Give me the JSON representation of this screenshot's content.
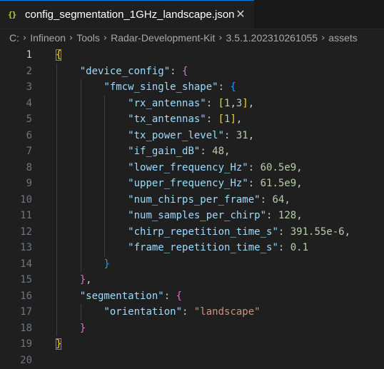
{
  "tab": {
    "icon": "{}",
    "title": "config_segmentation_1GHz_landscape.json",
    "close": "✕"
  },
  "breadcrumb": [
    "C:",
    "Infineon",
    "Tools",
    "Radar-Development-Kit",
    "3.5.1.202310261055",
    "assets"
  ],
  "lines": [
    {
      "num": "1",
      "indent": 0,
      "tokens": [
        {
          "t": "{",
          "c": "b1 bm"
        }
      ]
    },
    {
      "num": "2",
      "indent": 1,
      "tokens": [
        {
          "t": "\"device_config\"",
          "c": "tk-key"
        },
        {
          "t": ": ",
          "c": "tk-p"
        },
        {
          "t": "{",
          "c": "b2"
        }
      ]
    },
    {
      "num": "3",
      "indent": 2,
      "tokens": [
        {
          "t": "\"fmcw_single_shape\"",
          "c": "tk-key"
        },
        {
          "t": ": ",
          "c": "tk-p"
        },
        {
          "t": "{",
          "c": "b3"
        }
      ]
    },
    {
      "num": "4",
      "indent": 3,
      "tokens": [
        {
          "t": "\"rx_antennas\"",
          "c": "tk-key"
        },
        {
          "t": ": ",
          "c": "tk-p"
        },
        {
          "t": "[",
          "c": "b1"
        },
        {
          "t": "1",
          "c": "tk-num"
        },
        {
          "t": ",",
          "c": "tk-p"
        },
        {
          "t": "3",
          "c": "tk-num"
        },
        {
          "t": "]",
          "c": "b1"
        },
        {
          "t": ",",
          "c": "tk-p"
        }
      ]
    },
    {
      "num": "5",
      "indent": 3,
      "tokens": [
        {
          "t": "\"tx_antennas\"",
          "c": "tk-key"
        },
        {
          "t": ": ",
          "c": "tk-p"
        },
        {
          "t": "[",
          "c": "b1"
        },
        {
          "t": "1",
          "c": "tk-num"
        },
        {
          "t": "]",
          "c": "b1"
        },
        {
          "t": ",",
          "c": "tk-p"
        }
      ]
    },
    {
      "num": "6",
      "indent": 3,
      "tokens": [
        {
          "t": "\"tx_power_level\"",
          "c": "tk-key"
        },
        {
          "t": ": ",
          "c": "tk-p"
        },
        {
          "t": "31",
          "c": "tk-num"
        },
        {
          "t": ",",
          "c": "tk-p"
        }
      ]
    },
    {
      "num": "7",
      "indent": 3,
      "tokens": [
        {
          "t": "\"if_gain_dB\"",
          "c": "tk-key"
        },
        {
          "t": ": ",
          "c": "tk-p"
        },
        {
          "t": "48",
          "c": "tk-num"
        },
        {
          "t": ",",
          "c": "tk-p"
        }
      ]
    },
    {
      "num": "8",
      "indent": 3,
      "tokens": [
        {
          "t": "\"lower_frequency_Hz\"",
          "c": "tk-key"
        },
        {
          "t": ": ",
          "c": "tk-p"
        },
        {
          "t": "60.5e9",
          "c": "tk-num"
        },
        {
          "t": ",",
          "c": "tk-p"
        }
      ]
    },
    {
      "num": "9",
      "indent": 3,
      "tokens": [
        {
          "t": "\"upper_frequency_Hz\"",
          "c": "tk-key"
        },
        {
          "t": ": ",
          "c": "tk-p"
        },
        {
          "t": "61.5e9",
          "c": "tk-num"
        },
        {
          "t": ",",
          "c": "tk-p"
        }
      ]
    },
    {
      "num": "10",
      "indent": 3,
      "tokens": [
        {
          "t": "\"num_chirps_per_frame\"",
          "c": "tk-key"
        },
        {
          "t": ": ",
          "c": "tk-p"
        },
        {
          "t": "64",
          "c": "tk-num"
        },
        {
          "t": ",",
          "c": "tk-p"
        }
      ]
    },
    {
      "num": "11",
      "indent": 3,
      "tokens": [
        {
          "t": "\"num_samples_per_chirp\"",
          "c": "tk-key"
        },
        {
          "t": ": ",
          "c": "tk-p"
        },
        {
          "t": "128",
          "c": "tk-num"
        },
        {
          "t": ",",
          "c": "tk-p"
        }
      ]
    },
    {
      "num": "12",
      "indent": 3,
      "tokens": [
        {
          "t": "\"chirp_repetition_time_s\"",
          "c": "tk-key"
        },
        {
          "t": ": ",
          "c": "tk-p"
        },
        {
          "t": "391.55e-6",
          "c": "tk-num"
        },
        {
          "t": ",",
          "c": "tk-p"
        }
      ]
    },
    {
      "num": "13",
      "indent": 3,
      "tokens": [
        {
          "t": "\"frame_repetition_time_s\"",
          "c": "tk-key"
        },
        {
          "t": ": ",
          "c": "tk-p"
        },
        {
          "t": "0.1",
          "c": "tk-num"
        }
      ]
    },
    {
      "num": "14",
      "indent": 2,
      "tokens": [
        {
          "t": "}",
          "c": "b3"
        }
      ]
    },
    {
      "num": "15",
      "indent": 1,
      "tokens": [
        {
          "t": "}",
          "c": "b2"
        },
        {
          "t": ",",
          "c": "tk-p"
        }
      ]
    },
    {
      "num": "16",
      "indent": 1,
      "tokens": [
        {
          "t": "\"segmentation\"",
          "c": "tk-key"
        },
        {
          "t": ": ",
          "c": "tk-p"
        },
        {
          "t": "{",
          "c": "b2"
        }
      ]
    },
    {
      "num": "17",
      "indent": 2,
      "tokens": [
        {
          "t": "\"orientation\"",
          "c": "tk-key"
        },
        {
          "t": ": ",
          "c": "tk-p"
        },
        {
          "t": "\"landscape\"",
          "c": "tk-str"
        }
      ]
    },
    {
      "num": "18",
      "indent": 1,
      "tokens": [
        {
          "t": "}",
          "c": "b2"
        }
      ]
    },
    {
      "num": "19",
      "indent": 0,
      "tokens": [
        {
          "t": "}",
          "c": "b1 bm"
        }
      ]
    },
    {
      "num": "20",
      "indent": 0,
      "tokens": []
    }
  ],
  "active_line": "1",
  "colors": {
    "background": "#1f1f1f",
    "key": "#9cdcfe",
    "string": "#ce9178",
    "number": "#b5cea8",
    "bracket_level_1": "#ffd700",
    "bracket_level_2": "#da70d6",
    "bracket_level_3": "#179fff",
    "tab_accent": "#0078d4"
  }
}
